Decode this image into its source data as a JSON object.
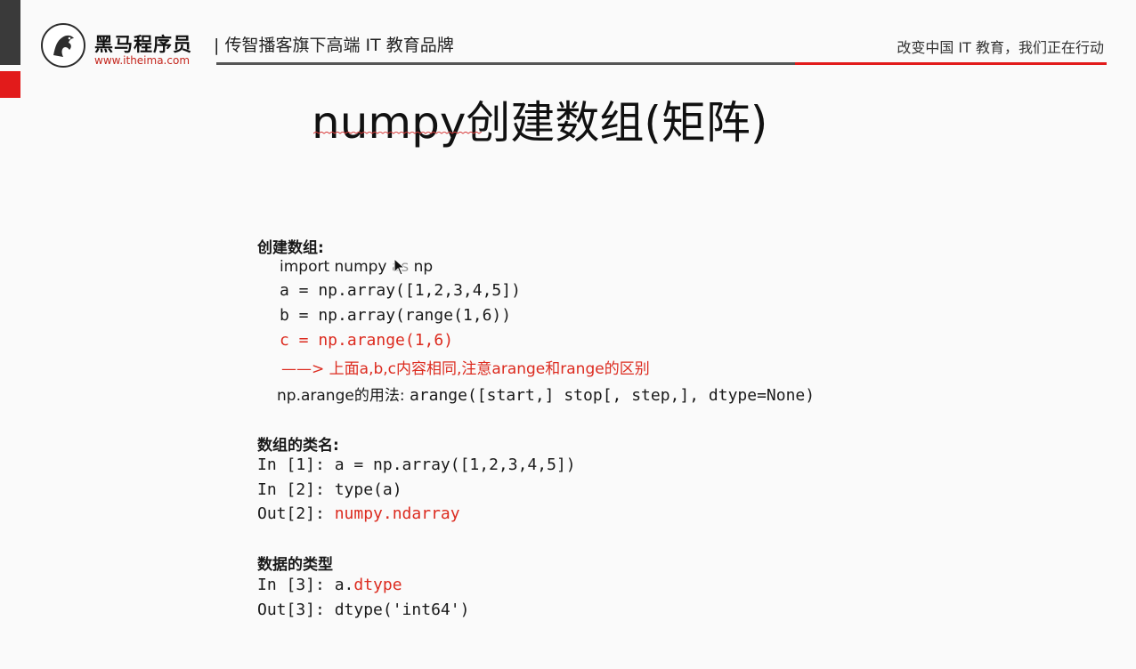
{
  "header": {
    "brand_name": "黑马程序员",
    "brand_url": "www.itheima.com",
    "tagline": "| 传智播客旗下高端 IT 教育品牌",
    "slogan": "改变中国 IT 教育，我们正在行动"
  },
  "title": "numpy创建数组(矩阵)",
  "section1": {
    "heading": "创建数组:",
    "import_prefix": "import numpy ",
    "import_hidden": "as",
    "import_suffix": " np",
    "line_a": "a = np.array([1,2,3,4,5])",
    "line_b": "b = np.array(range(1,6))",
    "line_c": "c = np.arange(1,6)",
    "note": "——> 上面a,b,c内容相同,注意arange和range的区别",
    "usage_label": "np.arange的用法: ",
    "usage_code": "arange([start,] stop[, step,], dtype=None)"
  },
  "section2": {
    "heading": "数组的类名:",
    "in1": "In [1]: a = np.array([1,2,3,4,5])",
    "in2": "In [2]: type(a)",
    "out2_label": "Out[2]: ",
    "out2_value": "numpy.ndarray"
  },
  "section3": {
    "heading": "数据的类型",
    "in3_label": "In [3]: a.",
    "in3_value": "dtype",
    "out3": "Out[3]: dtype('int64')"
  },
  "colors": {
    "accent_red": "#dc2b1f",
    "header_rule_dark": "#555555",
    "header_rule_red": "#e21b1b"
  },
  "icons": [
    "logo-horse-icon",
    "mouse-cursor-icon"
  ]
}
